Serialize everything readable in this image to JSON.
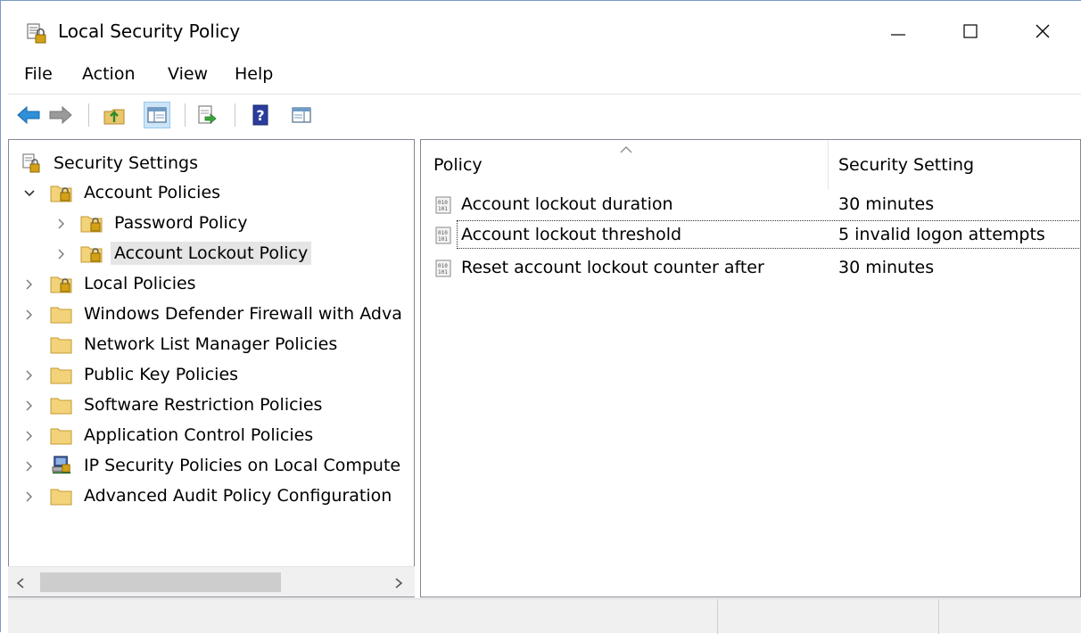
{
  "window": {
    "title": "Local Security Policy",
    "app_icon": "security-policy-icon"
  },
  "menu": [
    "File",
    "Action",
    "View",
    "Help"
  ],
  "toolbar": {
    "buttons": [
      "back-arrow-icon",
      "forward-arrow-icon",
      "up-folder-icon",
      "show-hide-tree-icon",
      "export-list-icon",
      "help-icon",
      "action-pane-icon"
    ]
  },
  "tree": {
    "items": [
      {
        "label": "Security Settings",
        "icon": "security-policy-icon",
        "expander": "none"
      },
      {
        "label": "Account Policies",
        "icon": "locked-folder-icon",
        "expander": "expanded"
      },
      {
        "label": "Password Policy",
        "icon": "locked-folder-icon",
        "expander": "collapsed"
      },
      {
        "label": "Account Lockout Policy",
        "icon": "locked-folder-icon",
        "expander": "collapsed",
        "selected": true
      },
      {
        "label": "Local Policies",
        "icon": "locked-folder-icon",
        "expander": "collapsed"
      },
      {
        "label": "Windows Defender Firewall with Adva",
        "icon": "folder-icon",
        "expander": "collapsed"
      },
      {
        "label": "Network List Manager Policies",
        "icon": "folder-icon",
        "expander": "none"
      },
      {
        "label": "Public Key Policies",
        "icon": "folder-icon",
        "expander": "collapsed"
      },
      {
        "label": "Software Restriction Policies",
        "icon": "folder-icon",
        "expander": "collapsed"
      },
      {
        "label": "Application Control Policies",
        "icon": "folder-icon",
        "expander": "collapsed"
      },
      {
        "label": "IP Security Policies on Local Compute",
        "icon": "ip-security-icon",
        "expander": "collapsed"
      },
      {
        "label": "Advanced Audit Policy Configuration",
        "icon": "folder-icon",
        "expander": "collapsed"
      }
    ]
  },
  "list": {
    "columns": [
      "Policy",
      "Security Setting"
    ],
    "sort_indicator": "sort-ascending-icon",
    "rows": [
      {
        "policy": "Account lockout duration",
        "setting": "30 minutes"
      },
      {
        "policy": "Account lockout threshold",
        "setting": "5 invalid logon attempts",
        "focused": true
      },
      {
        "policy": "Reset account lockout counter after",
        "setting": "30 minutes"
      }
    ]
  }
}
